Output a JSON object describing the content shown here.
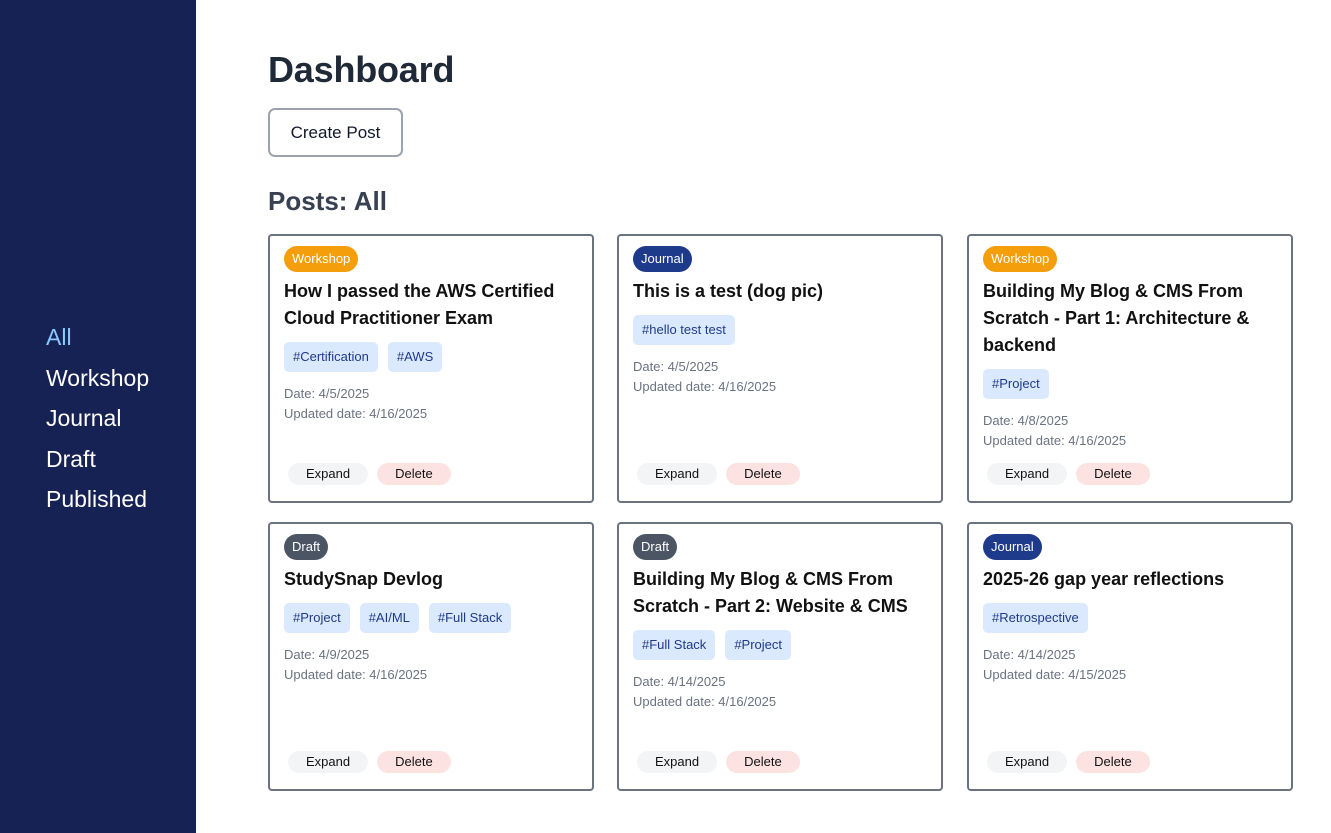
{
  "sidebar": {
    "items": [
      {
        "label": "All",
        "active": true
      },
      {
        "label": "Workshop",
        "active": false
      },
      {
        "label": "Journal",
        "active": false
      },
      {
        "label": "Draft",
        "active": false
      },
      {
        "label": "Published",
        "active": false
      }
    ]
  },
  "header": {
    "title": "Dashboard",
    "create_label": "Create Post"
  },
  "posts_heading": "Posts: All",
  "colors": {
    "sidebar_bg": "#172254",
    "nav_active": "#8cc8ff",
    "badge_workshop": "#f59e0b",
    "badge_journal": "#1e3a8a",
    "badge_draft": "#4b5563",
    "tag_bg": "#dbe9fe",
    "tag_text": "#1e3a8a"
  },
  "card_labels": {
    "expand": "Expand",
    "delete": "Delete"
  },
  "posts": [
    {
      "category": "Workshop",
      "title": "How I passed the AWS Certified Cloud Practitioner Exam",
      "tags": [
        "#Certification",
        "#AWS"
      ],
      "date": "Date: 4/5/2025",
      "updated": "Updated date: 4/16/2025"
    },
    {
      "category": "Journal",
      "title": "This is a test (dog pic)",
      "tags": [
        "#hello test test"
      ],
      "date": "Date: 4/5/2025",
      "updated": "Updated date: 4/16/2025"
    },
    {
      "category": "Workshop",
      "title": "Building My Blog & CMS From Scratch - Part 1: Architecture & backend",
      "tags": [
        "#Project"
      ],
      "date": "Date: 4/8/2025",
      "updated": "Updated date: 4/16/2025"
    },
    {
      "category": "Draft",
      "title": "StudySnap Devlog",
      "tags": [
        "#Project",
        "#AI/ML",
        "#Full Stack"
      ],
      "date": "Date: 4/9/2025",
      "updated": "Updated date: 4/16/2025"
    },
    {
      "category": "Draft",
      "title": "Building My Blog & CMS From Scratch - Part 2: Website & CMS",
      "tags": [
        "#Full Stack",
        "#Project"
      ],
      "date": "Date: 4/14/2025",
      "updated": "Updated date: 4/16/2025"
    },
    {
      "category": "Journal",
      "title": "2025-26 gap year reflections",
      "tags": [
        "#Retrospective"
      ],
      "date": "Date: 4/14/2025",
      "updated": "Updated date: 4/15/2025"
    }
  ]
}
